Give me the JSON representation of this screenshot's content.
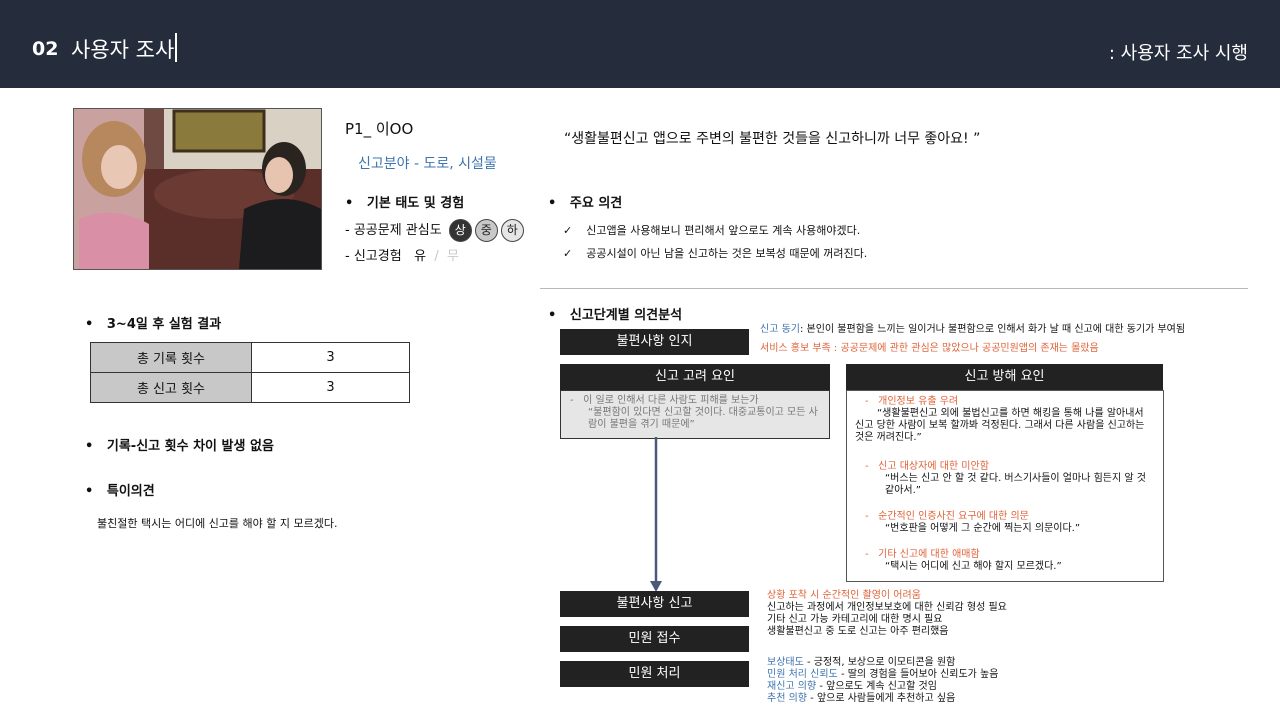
{
  "header": {
    "number": "02",
    "title": "사용자 조사",
    "subtitle": ": 사용자 조사 시행"
  },
  "profile": {
    "participant": "P1_ 이OO",
    "field": "신고분야 - 도로, 시설물",
    "quote": "“생활불편신고 앱으로 주변의 불편한 것들을 신고하니까 너무 좋아요! ”",
    "attitude_heading": "기본 태도 및 경험",
    "interest_label": "- 공공문제 관심도",
    "levels": [
      "상",
      "중",
      "하"
    ],
    "experience_label": "- 신고경험",
    "experience_yes": "유",
    "experience_sep": "/",
    "experience_no": "무",
    "opinion_heading": "주요 의견",
    "opinions": [
      "신고앱을 사용해보니 편리해서 앞으로도 계속 사용해야겠다.",
      "공공시설이 아닌 남을 신고하는 것은 보복성 때문에 꺼려진다."
    ]
  },
  "experiment": {
    "heading": "3~4일 후 실험 결과",
    "rows": [
      {
        "label": "총 기록 횟수",
        "value": "3"
      },
      {
        "label": "총 신고 횟수",
        "value": "3"
      }
    ],
    "finding": "기록-신고 횟수 차이 발생 없음",
    "special_heading": "특이의견",
    "special_text": "불친절한 택시는 어디에 신고를 해야 할 지 모르겠다."
  },
  "stages": {
    "heading": "신고단계별 의견분석",
    "recognition": "불편사항 인지",
    "motive_label": "신고 동기",
    "motive_text": ": 본인이 불편함을 느끼는 일이거나 불편함으로 인해서 화가 날 때 신고에 대한 동기가 부여됨",
    "promo_text": "서비스 홍보 부족 : 공공문제에 관한 관심은 많았으나 공공민원앱의 존재는 몰랐음",
    "consider_title": "신고 고려 요인",
    "consider_line1": "이 일로 인해서 다른 사람도 피해를 보는가",
    "consider_quote": "“불편함이 있다면 신고할 것이다. 대중교통이고 모든 사람이 불편을 겪기 때문에”",
    "barrier_title": "신고 방해 요인",
    "barriers": [
      {
        "title": "개인정보 유출 우려",
        "quote": "“생활불편신고 외에 불법신고를 하면 해킹을 통해 나를 알아내서 신고 당한 사람이 보복 할까봐 걱정된다. 그래서 다른 사람을 신고하는 것은 꺼려진다.”"
      },
      {
        "title": "신고 대상자에 대한 미안함",
        "quote": "“버스는 신고 안 할 것 같다. 버스기사들이 얼마나 힘든지 알 것 같아서.”"
      },
      {
        "title": "순간적인 인증사진 요구에 대한 의문",
        "quote": "“번호판을 어떻게 그 순간에 찍는지 의문이다.”"
      },
      {
        "title": "기타 신고에 대한 애매함",
        "quote": "“택시는 어디에 신고 해야 할지 모르겠다.”"
      }
    ],
    "report": "불편사항 신고",
    "report_notes": [
      "상황 포착 시 순간적인 촬영이 어려움",
      "신고하는 과정에서 개인정보보호에 대한 신뢰감 형성 필요",
      "기타 신고 가능 카테고리에 대한 명시 필요",
      "생활불편신고 중 도로 신고는 아주 편리했음"
    ],
    "receipt": "민원 접수",
    "process": "민원 처리",
    "process_notes": [
      {
        "label": "보상태도",
        "text": " - 긍정적,  보상으로 이모티콘을 원함"
      },
      {
        "label": "민원 처리 신뢰도",
        "text": " - 딸의 경험을 들어보아 신뢰도가 높음"
      },
      {
        "label": "재신고 의향",
        "text": " -  앞으로도 계속 신고할 것임"
      },
      {
        "label": "추천 의향",
        "text": " - 앞으로 사람들에게 추천하고 싶음"
      }
    ]
  },
  "colors": {
    "header_bg": "#252d3c",
    "accent_red": "#e0633a",
    "accent_blue": "#3e74b0"
  }
}
